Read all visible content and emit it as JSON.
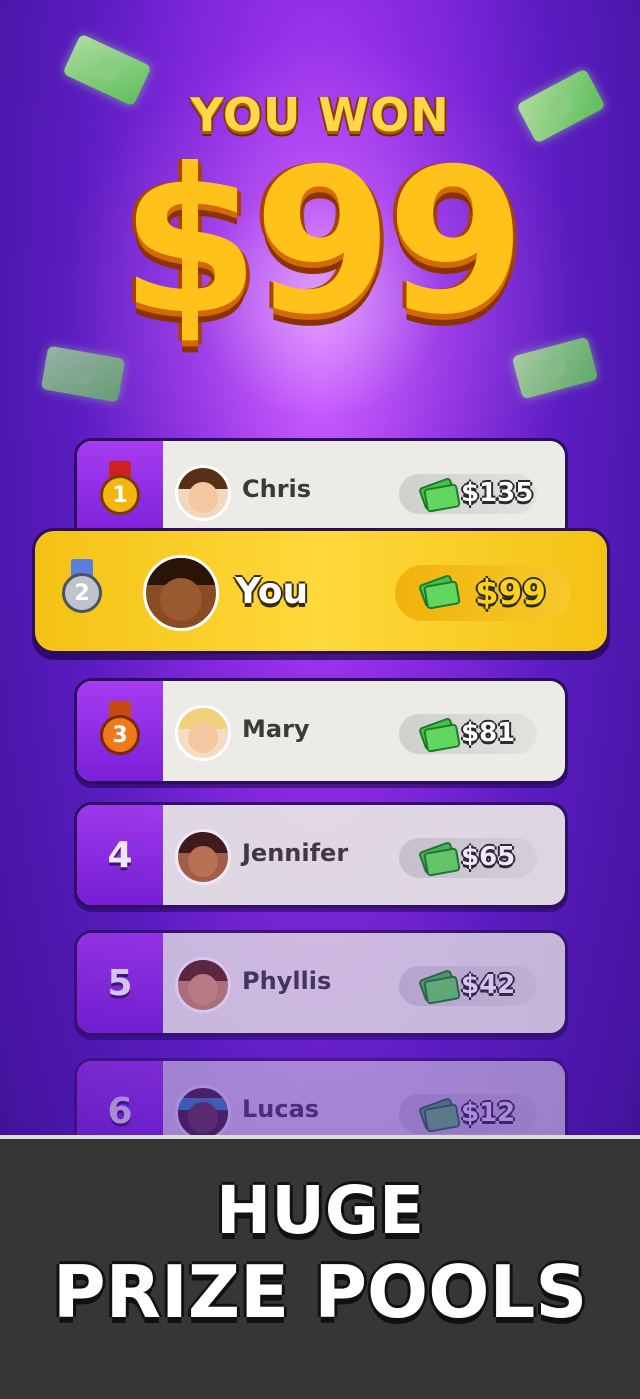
{
  "hero": {
    "headline": "YOU WON",
    "amount": "$99"
  },
  "leaderboard": [
    {
      "rank": "1",
      "medal": "gold-medal-icon",
      "name": "Chris",
      "prize": "$135"
    },
    {
      "rank": "2",
      "medal": "silver-medal-icon",
      "name": "You",
      "prize": "$99",
      "highlight": true
    },
    {
      "rank": "3",
      "medal": "bronze-medal-icon",
      "name": "Mary",
      "prize": "$81"
    },
    {
      "rank": "4",
      "name": "Jennifer",
      "prize": "$65"
    },
    {
      "rank": "5",
      "name": "Phyllis",
      "prize": "$42"
    },
    {
      "rank": "6",
      "name": "Lucas",
      "prize": "$12"
    }
  ],
  "promo": {
    "line1": "HUGE",
    "line2": "PRIZE POOLS"
  },
  "colors": {
    "background": "#6a1fd0",
    "highlight_row": "#ffd93b",
    "rank_column": "#9a32ea",
    "cash": "#45c24a"
  }
}
